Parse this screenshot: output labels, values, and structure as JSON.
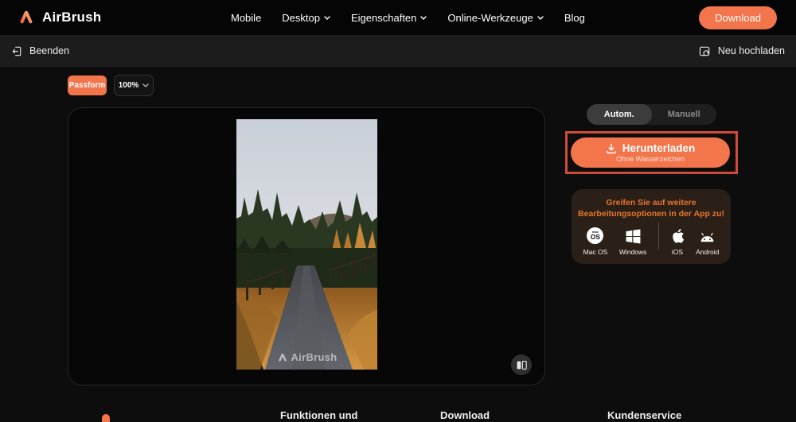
{
  "header": {
    "brand": "AirBrush",
    "nav": [
      {
        "label": "Mobile",
        "dropdown": false
      },
      {
        "label": "Desktop",
        "dropdown": true
      },
      {
        "label": "Eigenschaften",
        "dropdown": true
      },
      {
        "label": "Online-Werkzeuge",
        "dropdown": true
      },
      {
        "label": "Blog",
        "dropdown": false
      }
    ],
    "download_label": "Download"
  },
  "toolbar": {
    "exit_label": "Beenden",
    "reupload_label": "Neu hochladen"
  },
  "editor": {
    "fit_button": "Passform",
    "zoom_value": "100%",
    "watermark": "AirBrush"
  },
  "panel": {
    "tab_auto": "Autom.",
    "tab_manual": "Manuell",
    "download_button": "Herunterladen",
    "download_sub": "Ohne Wasserzeichen",
    "promo_title_line1": "Greifen Sie auf weitere",
    "promo_title_line2": "Bearbeitungsoptionen in der App zu!",
    "platforms": [
      {
        "name": "Mac OS"
      },
      {
        "name": "Windows"
      },
      {
        "name": "iOS"
      },
      {
        "name": "Android"
      }
    ],
    "macos_glyph_top": "mac",
    "macos_glyph_bottom": "OS"
  },
  "footer": {
    "col1": "Funktionen und",
    "col2": "Download",
    "col3": "Kundenservice"
  },
  "colors": {
    "accent": "#F2754B",
    "highlight_border": "#CE4B3A",
    "promo_text": "#E8742E",
    "header_bg": "#050505",
    "subheader_bg": "#1C1C1C"
  }
}
